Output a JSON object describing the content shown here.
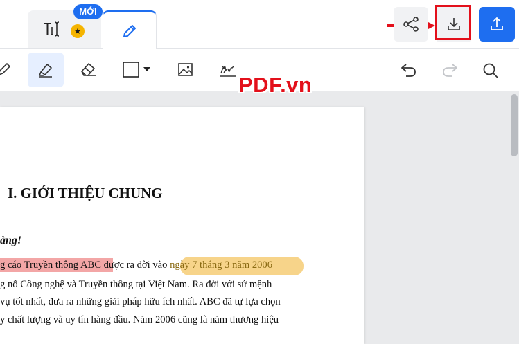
{
  "tabs": {
    "new_badge": "MỚI",
    "text_tab_icon": "text-cursor-icon",
    "edit_tab_icon": "pencil-icon"
  },
  "header_actions": {
    "share_icon": "share-icon",
    "download_icon": "download-icon",
    "upload_icon": "upload-icon"
  },
  "toolbar": {
    "tools": [
      "pencil-icon",
      "highlighter-icon",
      "eraser-icon",
      "rectangle-icon",
      "image-icon",
      "signature-icon",
      "undo-icon",
      "redo-icon",
      "search-icon"
    ]
  },
  "watermark": "PDF.vn",
  "document": {
    "heading": "I. GIỚI THIỆU CHUNG",
    "italic_line": "àng!",
    "line1_pink": "g cáo Truyền thông ABC",
    "line1_mid": " được ra đời vào",
    "line1_yellow": " ngày 7 tháng 3 năm 2006",
    "line2": "g nổ Công nghệ và Truyền thông tại Việt Nam. Ra đời với sứ mệnh",
    "line3": "vụ tốt nhất, đưa ra những giải pháp hữu ích nhất. ABC đã tự lựa chọn",
    "line4": "y chất lượng và uy tín hàng đầu. Năm 2006 cũng là năm thương hiệu"
  },
  "colors": {
    "accent": "#1e6ef0",
    "annotation_red": "#e3101b",
    "highlight_pink": "#f3a6a6",
    "highlight_yellow": "#f7d48a",
    "badge_star": "#f5b400"
  }
}
